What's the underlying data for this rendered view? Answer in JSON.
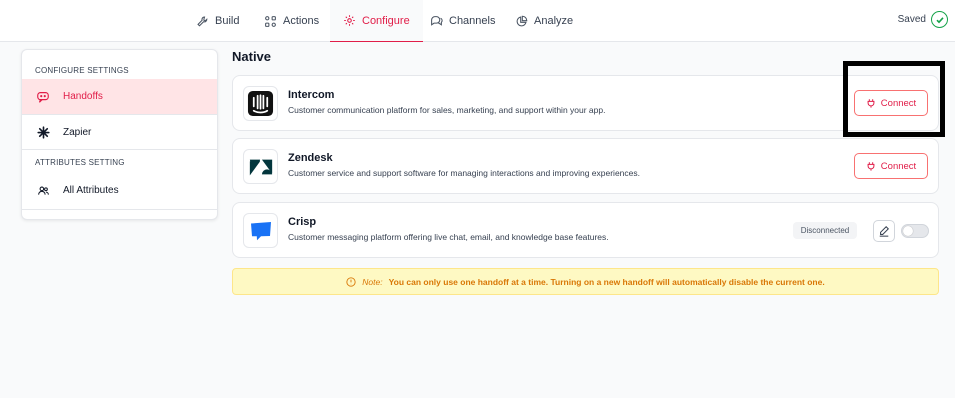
{
  "nav": {
    "tabs": [
      {
        "label": "Build",
        "icon": "wrench-icon"
      },
      {
        "label": "Actions",
        "icon": "actions-icon"
      },
      {
        "label": "Configure",
        "icon": "gear-icon"
      },
      {
        "label": "Channels",
        "icon": "chat-bubbles-icon"
      },
      {
        "label": "Analyze",
        "icon": "chart-pie-icon"
      }
    ],
    "active": "Configure",
    "status": "Saved"
  },
  "sidebar": {
    "configure_heading": "CONFIGURE SETTINGS",
    "items": [
      {
        "label": "Handoffs",
        "icon": "handoff-icon"
      },
      {
        "label": "Zapier",
        "icon": "zapier-icon"
      }
    ],
    "attributes_heading": "ATTRIBUTES SETTING",
    "attributes_items": [
      {
        "label": "All Attributes",
        "icon": "users-icon"
      }
    ]
  },
  "main": {
    "section_title": "Native",
    "integrations": [
      {
        "name": "Intercom",
        "description": "Customer communication platform for sales, marketing, and support within your app.",
        "action": "Connect"
      },
      {
        "name": "Zendesk",
        "description": "Customer service and support software for managing interactions and improving experiences.",
        "action": "Connect"
      },
      {
        "name": "Crisp",
        "description": "Customer messaging platform offering live chat, email, and knowledge base features.",
        "status": "Disconnected",
        "enabled": false
      }
    ],
    "note": {
      "lead": "Note:",
      "text": "You can only use one handoff at a time. Turning on a new handoff will automatically disable the current one."
    }
  },
  "colors": {
    "accent": "#e11d48",
    "success": "#16a34a",
    "note_bg": "#fef9c3",
    "note_text": "#d97706",
    "crisp_brand": "#1972f5",
    "zendesk_brand": "#03363d"
  }
}
